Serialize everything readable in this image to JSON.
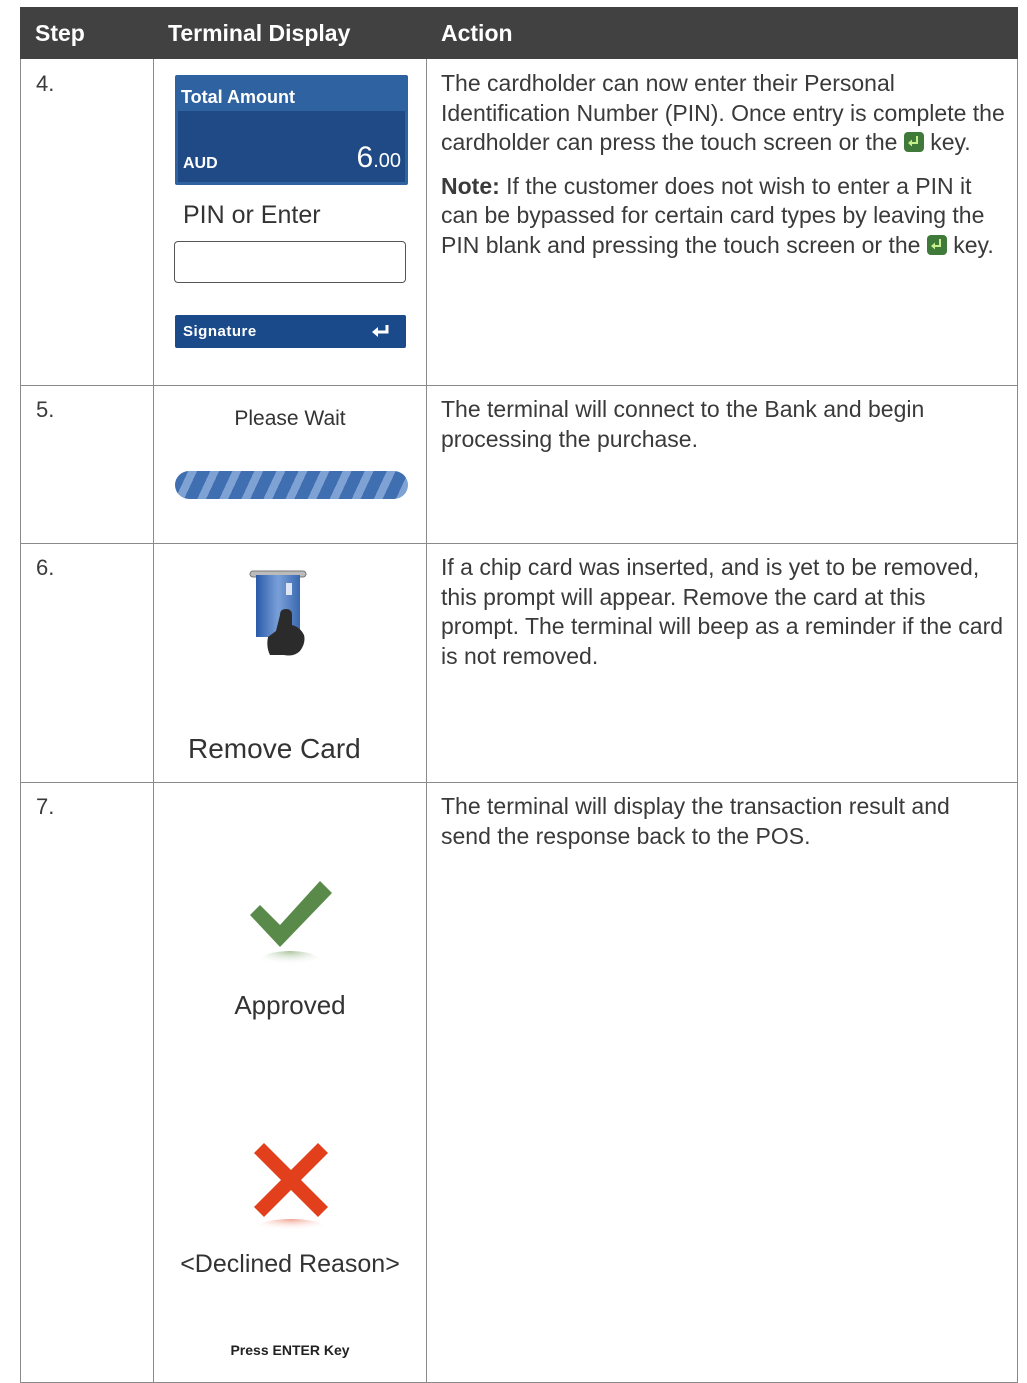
{
  "header": {
    "step": "Step",
    "display": "Terminal Display",
    "action": "Action"
  },
  "rows": [
    {
      "step": "4.",
      "display": {
        "total_label": "Total Amount",
        "currency": "AUD",
        "amount_main": "6",
        "amount_cents": ".00",
        "pin_label": "PIN or Enter",
        "signature_button": "Signature",
        "enter_icon": "enter-arrow-icon"
      },
      "action": {
        "p1_before_key": "The cardholder can now enter their Personal Identification Number (PIN). Once entry is complete the cardholder can press the touch screen or the",
        "p1_after_key": "key.",
        "note_label": "Note:",
        "note_before_key": "If the customer does not wish to enter a PIN it can be bypassed for certain card types by leaving the PIN blank and pressing the touch screen or the",
        "note_after_key": "key."
      }
    },
    {
      "step": "5.",
      "display": {
        "wait_label": "Please Wait",
        "progress_icon": "progress-bar"
      },
      "action": {
        "text": "The terminal will connect to the Bank and begin processing the purchase."
      }
    },
    {
      "step": "6.",
      "display": {
        "remove_icon": "remove-card-icon",
        "remove_label": "Remove Card"
      },
      "action": {
        "text": "If a chip card was inserted, and is yet to be removed, this prompt will appear. Remove the card at this prompt. The terminal will beep as a reminder if the card is not removed."
      }
    },
    {
      "step": "7.",
      "display": {
        "approved_icon": "green-check-icon",
        "approved_label": "Approved",
        "declined_icon": "red-cross-icon",
        "declined_label": "<Declined Reason>",
        "press_label": "Press ENTER Key"
      },
      "action": {
        "text": "The terminal will display the transaction result and send the response back to the POS."
      }
    }
  ],
  "colors": {
    "header_bg": "#414141",
    "terminal_blue": "#2f62a0",
    "enter_key_green": "#3f7a3a",
    "approved_green": "#5a8a4a",
    "declined_red": "#e2401c"
  }
}
